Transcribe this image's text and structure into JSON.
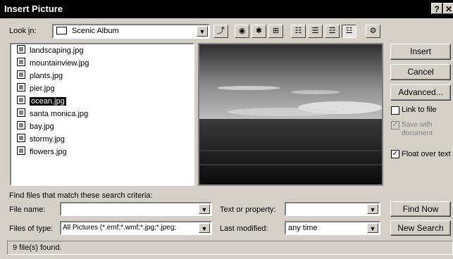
{
  "window": {
    "title": "Insert Picture",
    "help_btn": "?",
    "close_btn": "✕"
  },
  "lookin": {
    "label": "Look in:",
    "value": "Scenic Album"
  },
  "files": [
    {
      "name": "landscaping.jpg",
      "selected": false
    },
    {
      "name": "mountainview.jpg",
      "selected": false
    },
    {
      "name": "plants.jpg",
      "selected": false
    },
    {
      "name": "pier.jpg",
      "selected": false
    },
    {
      "name": "ocean.jpg",
      "selected": true
    },
    {
      "name": "santa monica.jpg",
      "selected": false
    },
    {
      "name": "bay.jpg",
      "selected": false
    },
    {
      "name": "stormy.jpg",
      "selected": false
    },
    {
      "name": "flowers.jpg",
      "selected": false
    }
  ],
  "buttons": {
    "insert": "Insert",
    "cancel": "Cancel",
    "advanced": "Advanced...",
    "find_now": "Find Now",
    "new_search": "New Search"
  },
  "options": {
    "link_to_file": {
      "label": "Link to file",
      "checked": false
    },
    "save_with_document": {
      "label": "Save with document",
      "checked": true,
      "disabled": true
    },
    "float_over_text": {
      "label": "Float over text",
      "checked": true
    }
  },
  "search": {
    "heading": "Find files that match these search criteria:",
    "file_name_label": "File name:",
    "file_name_value": "",
    "files_of_type_label": "Files of type:",
    "files_of_type_value": "All Pictures (*.emf;*.wmf;*.jpg;*.jpeg;",
    "text_property_label": "Text or property:",
    "text_property_value": "",
    "last_modified_label": "Last modified:",
    "last_modified_value": "any time"
  },
  "status": "9 file(s) found."
}
